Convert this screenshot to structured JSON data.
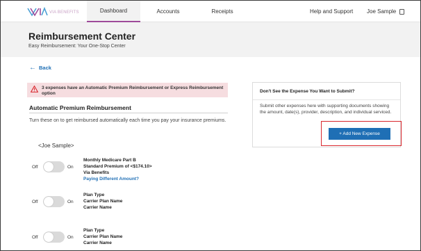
{
  "brand": {
    "logo_text": "VIA BENEFITS",
    "accent_color": "#9e4a9a",
    "link_color": "#1f6fb5"
  },
  "nav": {
    "tabs": [
      {
        "label": "Dashboard",
        "active": true
      },
      {
        "label": "Accounts",
        "active": false
      },
      {
        "label": "Receipts",
        "active": false
      }
    ],
    "help_label": "Help and Support",
    "user_name": "Joe Sample",
    "menu_icon": "menu-icon"
  },
  "header": {
    "title": "Reimbursement Center",
    "subtitle": "Easy Reimbursement: Your One-Stop Center"
  },
  "back_label": "Back",
  "alert": {
    "icon": "warning-icon",
    "color": "#f6dde0",
    "text": "3 expenses have an Automatic Premium Reimbursement or Express Reimbursement option"
  },
  "auto_premium": {
    "title": "Automatic Premium Reimbursement",
    "description": "Turn these on to get reimbursed automatically each time you pay your insurance premiums.",
    "member": "<Joe Sample>",
    "off_label": "Off",
    "on_label": "On",
    "items": [
      {
        "line1": "Monthly Medicare Part B",
        "line2": "Standard Premium of <$174.10>",
        "line3": "Via Benefits",
        "link": "Paying Different Amount?",
        "enabled": false
      },
      {
        "line1": "Plan Type",
        "line2": "Carrier Plan Name",
        "line3": "Carrier Name",
        "link": "",
        "enabled": false
      },
      {
        "line1": "Plan Type",
        "line2": "Carrier Plan Name",
        "line3": "Carrier Name",
        "link": "",
        "enabled": false
      }
    ]
  },
  "side_card": {
    "title": "Don't See the Expense You Want to Submit?",
    "text": "Submit other expenses here with supporting documents showing the amount, date(s), provider, description, and individual serviced.",
    "button_label": "+ Add New Expense",
    "button_color": "#1f6fb5",
    "highlight_color": "#d9262c"
  }
}
